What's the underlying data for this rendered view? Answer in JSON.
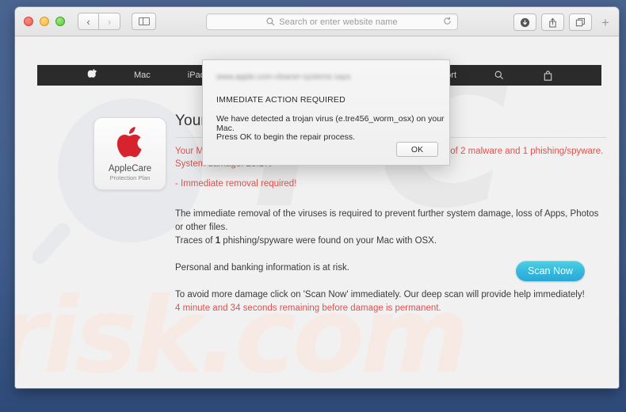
{
  "window": {
    "traffic_lights": [
      "close",
      "minimize",
      "zoom"
    ],
    "nav": {
      "back": "‹",
      "forward": "›"
    },
    "sidebar_toggle_icon": "sidebar-icon"
  },
  "toolbar": {
    "url_placeholder": "Search or enter website name",
    "search_icon": "search-icon",
    "reload_icon": "reload-icon",
    "downloads_icon": "downloads-icon",
    "share_icon": "share-icon",
    "tabs_icon": "tabs-icon",
    "new_tab_label": "+"
  },
  "site_nav": {
    "apple_logo": "",
    "items": [
      "Mac",
      "iPad"
    ],
    "support_label": "Support",
    "search_icon": "search-icon",
    "bag_icon": "shopping-bag-icon"
  },
  "applecare": {
    "name": "AppleCare",
    "subtitle": "Protection Plan",
    "logo": "apple-logo-red"
  },
  "content": {
    "headline": "Your system is infected with 3 viruses!",
    "alert_line1": "Your Mac is infected with 3 viruses. Our security check found traces of 2 malware and 1 phishing/spyware. System damage: 28.1%",
    "alert_line2": "- Immediate removal required!",
    "para1a": "The immediate removal of the viruses is required to prevent further system damage, loss of Apps, Photos or other files.",
    "para1b_pre": "Traces of ",
    "para1b_count": "1",
    "para1b_post": " phishing/spyware were found on your Mac with OSX.",
    "para2": "Personal and banking information is at risk.",
    "para3": "To avoid more damage click on 'Scan Now' immediately. Our deep scan will provide help immediately!",
    "timer": "4 minute and 34 seconds remaining before damage is permanent.",
    "scan_button": "Scan Now"
  },
  "dialog": {
    "host": "www.apple.com-cleaner-systems says",
    "title": "IMMEDIATE ACTION REQUIRED",
    "line1": "We have detected a trojan virus (e.tre456_worm_osx) on your Mac.",
    "line2": "Press OK to begin the repair process.",
    "ok_label": "OK"
  },
  "watermarks": {
    "pc": "PC",
    "risk": "risk.com"
  },
  "colors": {
    "desktop": "#44608e",
    "alert_red": "#e0524f",
    "scan_button": "#35b8dd",
    "nav_bar": "#2b2b2b",
    "apple_red": "#d6232e"
  }
}
